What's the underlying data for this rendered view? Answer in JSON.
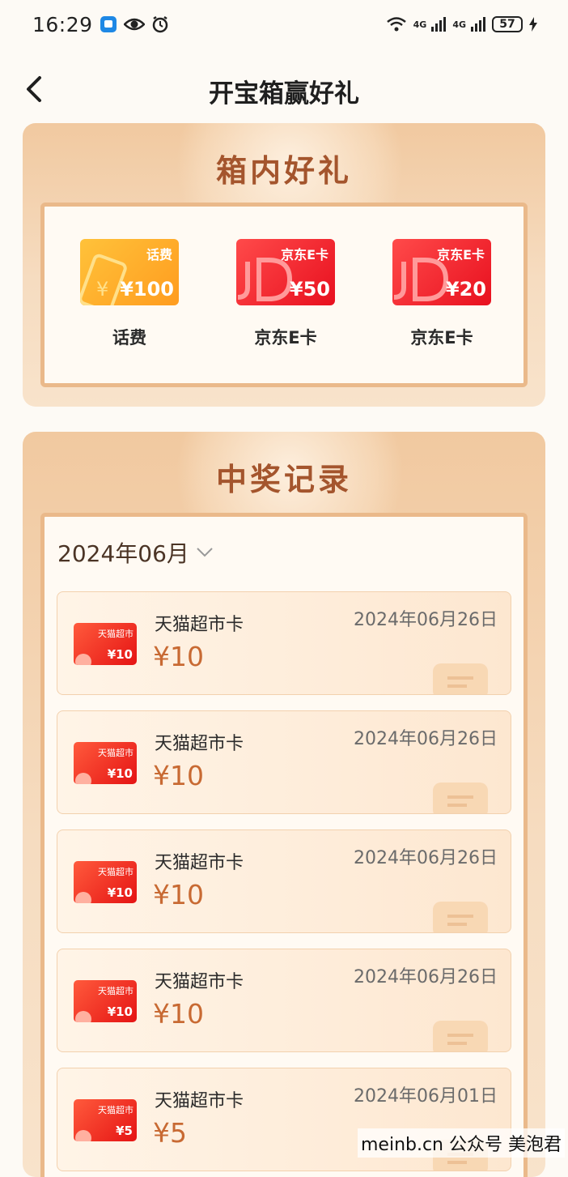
{
  "status_bar": {
    "time": "16:29",
    "network_1": "4G",
    "network_2": "4G",
    "battery": "57"
  },
  "header": {
    "title": "开宝箱赢好礼"
  },
  "prizes_section": {
    "title": "箱内好礼",
    "items": [
      {
        "card_label": "话费",
        "card_amount": "¥100",
        "name": "话费",
        "type": "phone-credit"
      },
      {
        "card_label": "京东E卡",
        "card_amount": "¥50",
        "name": "京东E卡",
        "type": "jd-card"
      },
      {
        "card_label": "京东E卡",
        "card_amount": "¥20",
        "name": "京东E卡",
        "type": "jd-card"
      }
    ]
  },
  "records_section": {
    "title": "中奖记录",
    "month": "2024年06月",
    "records": [
      {
        "card_label": "天猫超市",
        "card_amount": "¥10",
        "name": "天猫超市卡",
        "amount": "¥10",
        "date": "2024年06月26日"
      },
      {
        "card_label": "天猫超市",
        "card_amount": "¥10",
        "name": "天猫超市卡",
        "amount": "¥10",
        "date": "2024年06月26日"
      },
      {
        "card_label": "天猫超市",
        "card_amount": "¥10",
        "name": "天猫超市卡",
        "amount": "¥10",
        "date": "2024年06月26日"
      },
      {
        "card_label": "天猫超市",
        "card_amount": "¥10",
        "name": "天猫超市卡",
        "amount": "¥10",
        "date": "2024年06月26日"
      },
      {
        "card_label": "天猫超市",
        "card_amount": "¥5",
        "name": "天猫超市卡",
        "amount": "¥5",
        "date": "2024年06月01日"
      }
    ]
  },
  "watermark": "meinb.cn 公众号 美泡君",
  "colors": {
    "accent": "#a4552d",
    "panel": "#f1c9a0",
    "amount": "#c86a33"
  }
}
